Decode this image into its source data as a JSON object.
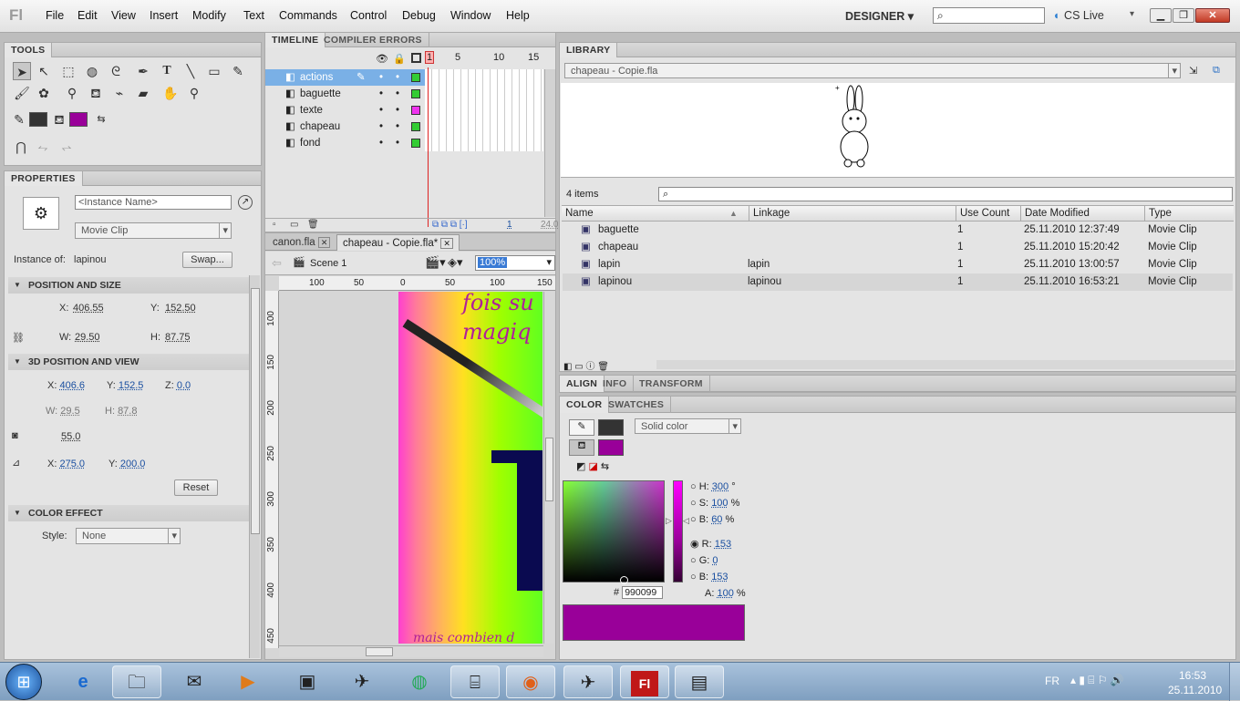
{
  "menubar": {
    "logo": "Fl",
    "items": [
      "File",
      "Edit",
      "View",
      "Insert",
      "Modify",
      "Text",
      "Commands",
      "Control",
      "Debug",
      "Window",
      "Help"
    ],
    "workspace": "DESIGNER",
    "cslive": "CS Live"
  },
  "tools": {
    "tab": "TOOLS"
  },
  "properties": {
    "tab": "PROPERTIES",
    "instance_name_placeholder": "<Instance Name>",
    "symbol_type": "Movie Clip",
    "instance_of_label": "Instance of:",
    "instance_of": "lapinou",
    "swap": "Swap...",
    "pos_section": "POSITION AND SIZE",
    "x_label": "X:",
    "x": "406.55",
    "y_label": "Y:",
    "y": "152.50",
    "w_label": "W:",
    "w": "29.50",
    "h_label": "H:",
    "h": "87.75",
    "pos3d_section": "3D POSITION AND VIEW",
    "x3d": "406.6",
    "y3d": "152.5",
    "z_label": "Z:",
    "z3d": "0.0",
    "w3d": "29.5",
    "h3d": "87.8",
    "perspective": "55.0",
    "vx": "275.0",
    "vy": "200.0",
    "reset": "Reset",
    "color_section": "COLOR EFFECT",
    "style_label": "Style:",
    "style": "None"
  },
  "timeline": {
    "tab": "TIMELINE",
    "tab2": "COMPILER ERRORS",
    "frames": [
      "1",
      "5",
      "10",
      "15"
    ],
    "layers": [
      "actions",
      "baguette",
      "texte",
      "chapeau",
      "fond"
    ],
    "frame_num": "1",
    "fps": "24.0"
  },
  "document": {
    "tabs": [
      "canon.fla",
      "chapeau - Copie.fla*"
    ],
    "scene": "Scene 1",
    "zoom": "100%",
    "hruler": [
      "100",
      "50",
      "0",
      "50",
      "100",
      "150"
    ],
    "vruler": [
      "100",
      "150",
      "200",
      "250",
      "300",
      "350",
      "400",
      "450"
    ],
    "stage_text1": "fois su",
    "stage_text2": "magiq",
    "stage_text3": "mais combien d"
  },
  "library": {
    "tab": "LIBRARY",
    "file": "chapeau - Copie.fla",
    "items_count": "4 items",
    "columns": [
      "Name",
      "Linkage",
      "Use Count",
      "Date Modified",
      "Type"
    ],
    "rows": [
      {
        "name": "baguette",
        "linkage": "",
        "count": "1",
        "date": "25.11.2010 12:37:49",
        "type": "Movie Clip"
      },
      {
        "name": "chapeau",
        "linkage": "",
        "count": "1",
        "date": "25.11.2010 15:20:42",
        "type": "Movie Clip"
      },
      {
        "name": "lapin",
        "linkage": "lapin",
        "count": "1",
        "date": "25.11.2010 13:00:57",
        "type": "Movie Clip"
      },
      {
        "name": "lapinou",
        "linkage": "lapinou",
        "count": "1",
        "date": "25.11.2010 16:53:21",
        "type": "Movie Clip"
      }
    ]
  },
  "align": {
    "tabs": [
      "ALIGN",
      "INFO",
      "TRANSFORM"
    ]
  },
  "color": {
    "tabs": [
      "COLOR",
      "SWATCHES"
    ],
    "fill_type": "Solid color",
    "H": "300",
    "S": "100",
    "B": "60",
    "R": "153",
    "G": "0",
    "Bv": "153",
    "hex": "990099",
    "A": "100",
    "deg": "°",
    "pct": "%",
    "hash": "#",
    "hl": "H:",
    "sl": "S:",
    "bl": "B:",
    "rl": "R:",
    "gl": "G:",
    "bvl": "B:",
    "al": "A:",
    "stroke_color": "#333333",
    "fill_color": "#990099"
  },
  "taskbar": {
    "lang": "FR",
    "time": "16:53",
    "date": "25.11.2010"
  }
}
